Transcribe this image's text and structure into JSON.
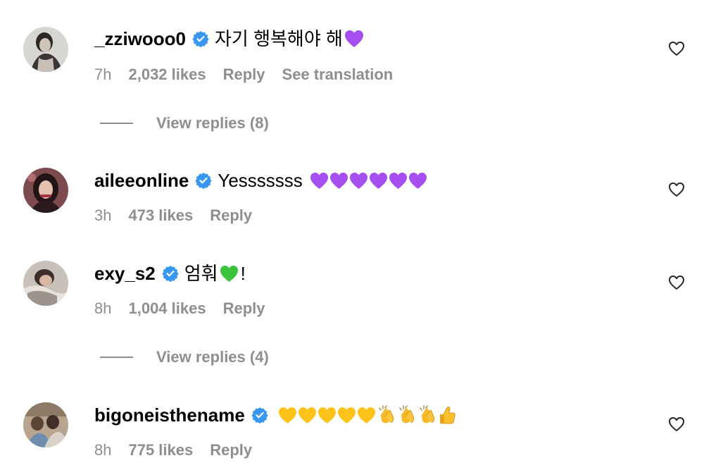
{
  "comments": [
    {
      "username": "_zziwooo0",
      "text": "자기 행복해야 해",
      "emoji": [
        "purple-heart"
      ],
      "time": "7h",
      "likes": "2,032 likes",
      "reply": "Reply",
      "translate": "See translation",
      "view_replies": "View replies (8)"
    },
    {
      "username": "aileeonline",
      "text": "Yesssssss",
      "emoji": [
        "purple-heart",
        "purple-heart",
        "purple-heart",
        "purple-heart",
        "purple-heart",
        "purple-heart"
      ],
      "time": "3h",
      "likes": "473 likes",
      "reply": "Reply"
    },
    {
      "username": "exy_s2",
      "text": "엄훠",
      "emoji": [
        "green-heart"
      ],
      "text_after": "!",
      "time": "8h",
      "likes": "1,004 likes",
      "reply": "Reply",
      "view_replies": "View replies (4)"
    },
    {
      "username": "bigoneisthename",
      "text": "",
      "emoji": [
        "yellow-heart",
        "yellow-heart",
        "yellow-heart",
        "yellow-heart",
        "yellow-heart",
        "clapping-hands",
        "clapping-hands",
        "clapping-hands",
        "thumbs-up"
      ],
      "time": "8h",
      "likes": "775 likes",
      "reply": "Reply"
    }
  ],
  "colors": {
    "verified": "#3897f0",
    "meta_text": "#8e8e8e",
    "purple_heart": "#a64ff0",
    "green_heart": "#39c43c",
    "yellow_heart": "#fdc31a"
  }
}
